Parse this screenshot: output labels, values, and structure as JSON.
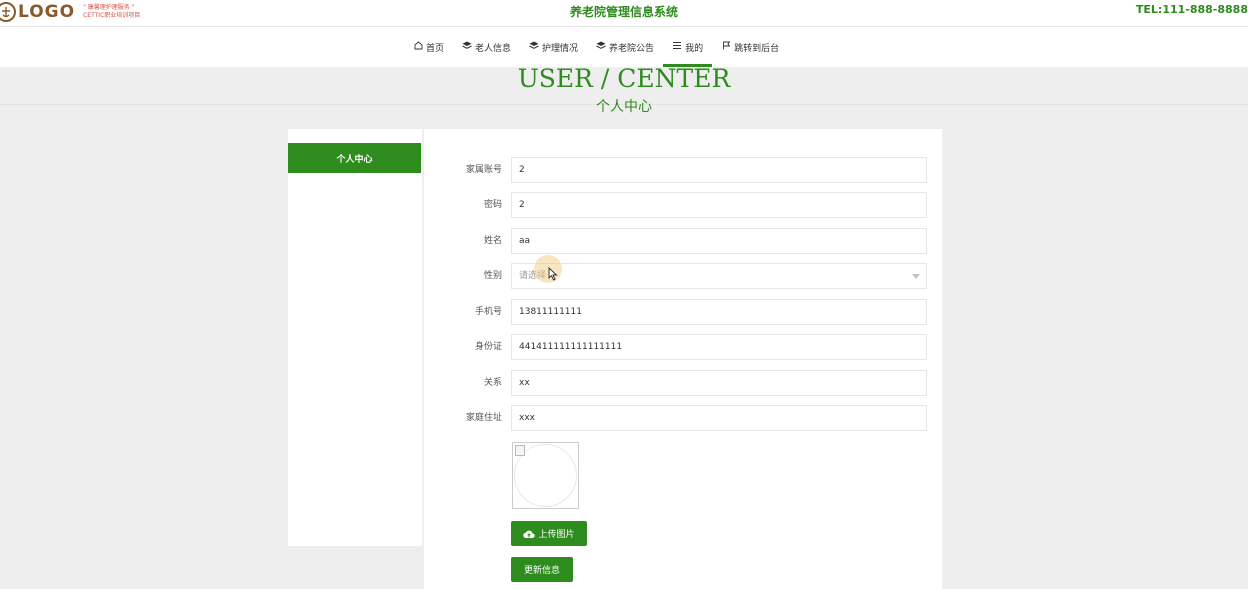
{
  "header": {
    "logo_text": "LOGO",
    "logo_tagline_1": "\" 康馨理护理服务 \"",
    "logo_tagline_2": "CETTIC职业培训项目",
    "site_title": "养老院管理信息系统",
    "tel": "TEL:111-888-8888"
  },
  "nav": {
    "items": [
      {
        "label": "首页",
        "icon": "home-icon"
      },
      {
        "label": "老人信息",
        "icon": "layers-icon"
      },
      {
        "label": "护理情况",
        "icon": "layers-icon"
      },
      {
        "label": "养老院公告",
        "icon": "layers-icon"
      },
      {
        "label": "我的",
        "icon": "menu-icon"
      },
      {
        "label": "跳转到后台",
        "icon": "flag-icon"
      }
    ],
    "active_index": 4
  },
  "hero": {
    "title_en": "USER / CENTER",
    "title_zh": "个人中心"
  },
  "sidebar": {
    "items": [
      {
        "label": "个人中心"
      }
    ]
  },
  "form": {
    "fields": [
      {
        "label": "家属账号",
        "value": "2"
      },
      {
        "label": "密码",
        "value": "2"
      },
      {
        "label": "姓名",
        "value": "aa"
      },
      {
        "label": "性别",
        "value": "请选择",
        "type": "select"
      },
      {
        "label": "手机号",
        "value": "13811111111"
      },
      {
        "label": "身份证",
        "value": "441411111111111111"
      },
      {
        "label": "关系",
        "value": "xx"
      },
      {
        "label": "家庭住址",
        "value": "xxx"
      }
    ],
    "upload_label": "上传图片",
    "save_label": "更新信息"
  },
  "colors": {
    "accent": "#2e8b1e",
    "logo_brown": "#8a5a2b",
    "page_bg": "#eeeeef"
  }
}
